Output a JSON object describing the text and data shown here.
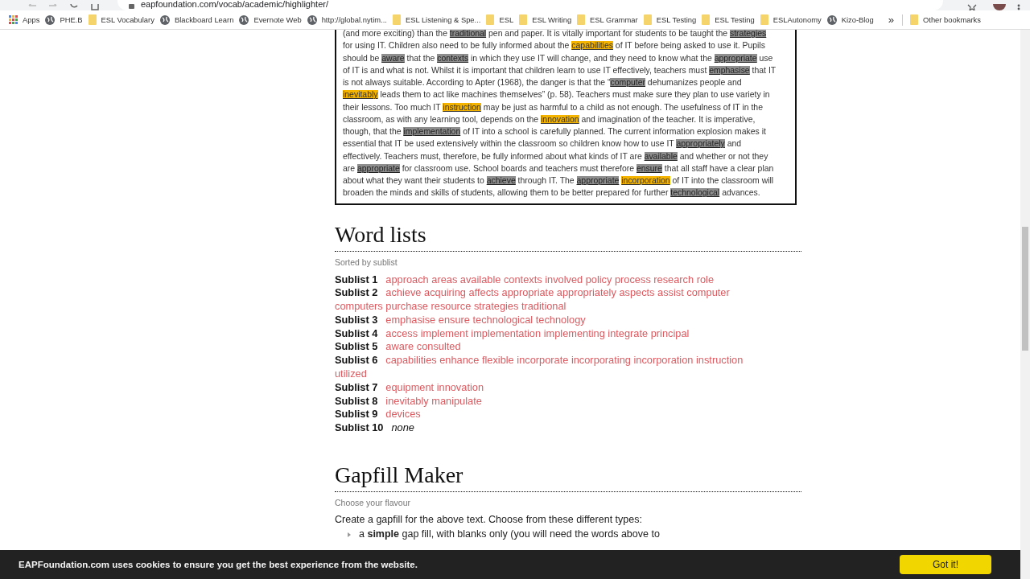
{
  "browser": {
    "address": "eapfoundation.com/vocab/academic/highlighter/",
    "bookmarks": [
      {
        "kind": "apps",
        "label": "Apps"
      },
      {
        "kind": "globe",
        "label": "PHE.B"
      },
      {
        "kind": "folder",
        "label": "ESL Vocabulary"
      },
      {
        "kind": "globe",
        "label": "Blackboard Learn"
      },
      {
        "kind": "globe",
        "label": "Evernote Web"
      },
      {
        "kind": "globe",
        "label": "http://global.nytim..."
      },
      {
        "kind": "folder",
        "label": "ESL Listening & Spe..."
      },
      {
        "kind": "folder",
        "label": "ESL"
      },
      {
        "kind": "folder",
        "label": "ESL Writing"
      },
      {
        "kind": "folder",
        "label": "ESL Grammar"
      },
      {
        "kind": "folder",
        "label": "ESL Testing"
      },
      {
        "kind": "folder",
        "label": "ESL Testing"
      },
      {
        "kind": "folder",
        "label": "ESLAutonomy"
      },
      {
        "kind": "globe",
        "label": "Kizo-Blog"
      }
    ],
    "overflow": "»",
    "other": "Other bookmarks"
  },
  "passage": [
    [
      {
        "kind": "plain",
        "text": "(and more exciting) than the "
      },
      {
        "kind": "grey",
        "text": "traditional"
      },
      {
        "kind": "plain",
        "text": " pen and paper. It is vitally important for students to be taught the "
      },
      {
        "kind": "grey",
        "text": "strategies"
      }
    ],
    [
      {
        "kind": "plain",
        "text": "for using IT. Children also need to be fully informed about the "
      },
      {
        "kind": "yellow",
        "text": "capabilities"
      },
      {
        "kind": "plain",
        "text": " of IT before being asked to use it. Pupils"
      }
    ],
    [
      {
        "kind": "plain",
        "text": "should be "
      },
      {
        "kind": "grey",
        "text": "aware"
      },
      {
        "kind": "plain",
        "text": " that the "
      },
      {
        "kind": "grey",
        "text": "contexts"
      },
      {
        "kind": "plain",
        "text": " in which they use IT will change, and they need to know what the "
      },
      {
        "kind": "grey",
        "text": "appropriate"
      },
      {
        "kind": "plain",
        "text": " use"
      }
    ],
    [
      {
        "kind": "plain",
        "text": "of IT is and what is not. Whilst it is important that children learn to use IT effectively, teachers must "
      },
      {
        "kind": "grey",
        "text": "emphasise"
      },
      {
        "kind": "plain",
        "text": " that IT"
      }
    ],
    [
      {
        "kind": "plain",
        "text": "is not always suitable. According to Apter (1968), the danger is that the “"
      },
      {
        "kind": "grey",
        "text": "computer"
      },
      {
        "kind": "plain",
        "text": " dehumanizes people and"
      }
    ],
    [
      {
        "kind": "yellow",
        "text": "inevitably"
      },
      {
        "kind": "plain",
        "text": " leads them to act like machines themselves” (p. 58). Teachers must make sure they plan to use variety in"
      }
    ],
    [
      {
        "kind": "plain",
        "text": "their lessons. Too much IT "
      },
      {
        "kind": "yellow",
        "text": "instruction"
      },
      {
        "kind": "plain",
        "text": " may be just as harmful to a child as not enough. The usefulness of IT in the"
      }
    ],
    [
      {
        "kind": "plain",
        "text": "classroom, as with any learning tool, depends on the "
      },
      {
        "kind": "yellow",
        "text": "innovation"
      },
      {
        "kind": "plain",
        "text": " and imagination of the teacher. It is imperative,"
      }
    ],
    [
      {
        "kind": "plain",
        "text": "though, that the "
      },
      {
        "kind": "grey",
        "text": "implementation"
      },
      {
        "kind": "plain",
        "text": " of IT into a school is carefully planned. The current information explosion makes it"
      }
    ],
    [
      {
        "kind": "plain",
        "text": "essential that IT be used extensively within the classroom so children know how to use IT "
      },
      {
        "kind": "grey",
        "text": "appropriately"
      },
      {
        "kind": "plain",
        "text": " and"
      }
    ],
    [
      {
        "kind": "plain",
        "text": "effectively. Teachers must, therefore, be fully informed about what kinds of IT are "
      },
      {
        "kind": "grey",
        "text": "available"
      },
      {
        "kind": "plain",
        "text": " and whether or not they"
      }
    ],
    [
      {
        "kind": "plain",
        "text": "are "
      },
      {
        "kind": "grey",
        "text": "appropriate"
      },
      {
        "kind": "plain",
        "text": " for classroom use. School boards and teachers must therefore "
      },
      {
        "kind": "grey",
        "text": "ensure"
      },
      {
        "kind": "plain",
        "text": " that all staff have a clear plan"
      }
    ],
    [
      {
        "kind": "plain",
        "text": "about what they want their students to "
      },
      {
        "kind": "grey",
        "text": "achieve"
      },
      {
        "kind": "plain",
        "text": " through IT. The "
      },
      {
        "kind": "grey",
        "text": "appropriate"
      },
      {
        "kind": "yellow",
        "text": "incorporation"
      },
      {
        "kind": "plain",
        "text": " of IT into the classroom will"
      }
    ],
    [
      {
        "kind": "plain",
        "text": "broaden the minds and skills of students, allowing them to be better prepared for further "
      },
      {
        "kind": "grey",
        "text": "technological"
      },
      {
        "kind": "plain",
        "text": " advances."
      }
    ]
  ],
  "word_lists": {
    "title": "Word lists",
    "subtitle": "Sorted by sublist",
    "sublists": [
      {
        "label": "Sublist 1",
        "words": [
          "approach",
          "areas",
          "available",
          "contexts",
          "involved",
          "policy",
          "process",
          "research",
          "role"
        ]
      },
      {
        "label": "Sublist 2",
        "words": [
          "achieve",
          "acquiring",
          "affects",
          "appropriate",
          "appropriately",
          "aspects",
          "assist",
          "computer",
          "computers",
          "purchase",
          "resource",
          "strategies",
          "traditional"
        ]
      },
      {
        "label": "Sublist 3",
        "words": [
          "emphasise",
          "ensure",
          "technological",
          "technology"
        ]
      },
      {
        "label": "Sublist 4",
        "words": [
          "access",
          "implement",
          "implementation",
          "implementing",
          "integrate",
          "principal"
        ]
      },
      {
        "label": "Sublist 5",
        "words": [
          "aware",
          "consulted"
        ]
      },
      {
        "label": "Sublist 6",
        "words": [
          "capabilities",
          "enhance",
          "flexible",
          "incorporate",
          "incorporating",
          "incorporation",
          "instruction",
          "utilized"
        ]
      },
      {
        "label": "Sublist 7",
        "words": [
          "equipment",
          "innovation"
        ]
      },
      {
        "label": "Sublist 8",
        "words": [
          "inevitably",
          "manipulate"
        ]
      },
      {
        "label": "Sublist 9",
        "words": [
          "devices"
        ]
      },
      {
        "label": "Sublist 10",
        "note": "none"
      }
    ]
  },
  "gapfill": {
    "title": "Gapfill Maker",
    "subtitle": "Choose your flavour",
    "intro": "Create a gapfill for the above text. Choose from these different types:",
    "options": [
      "a **simple** gap fill, with blanks only (you will need the words above to"
    ]
  },
  "cookie_bar": {
    "message": "EAPFoundation.com uses cookies to ensure you get the best experience from the website.",
    "button": "Got it!"
  }
}
